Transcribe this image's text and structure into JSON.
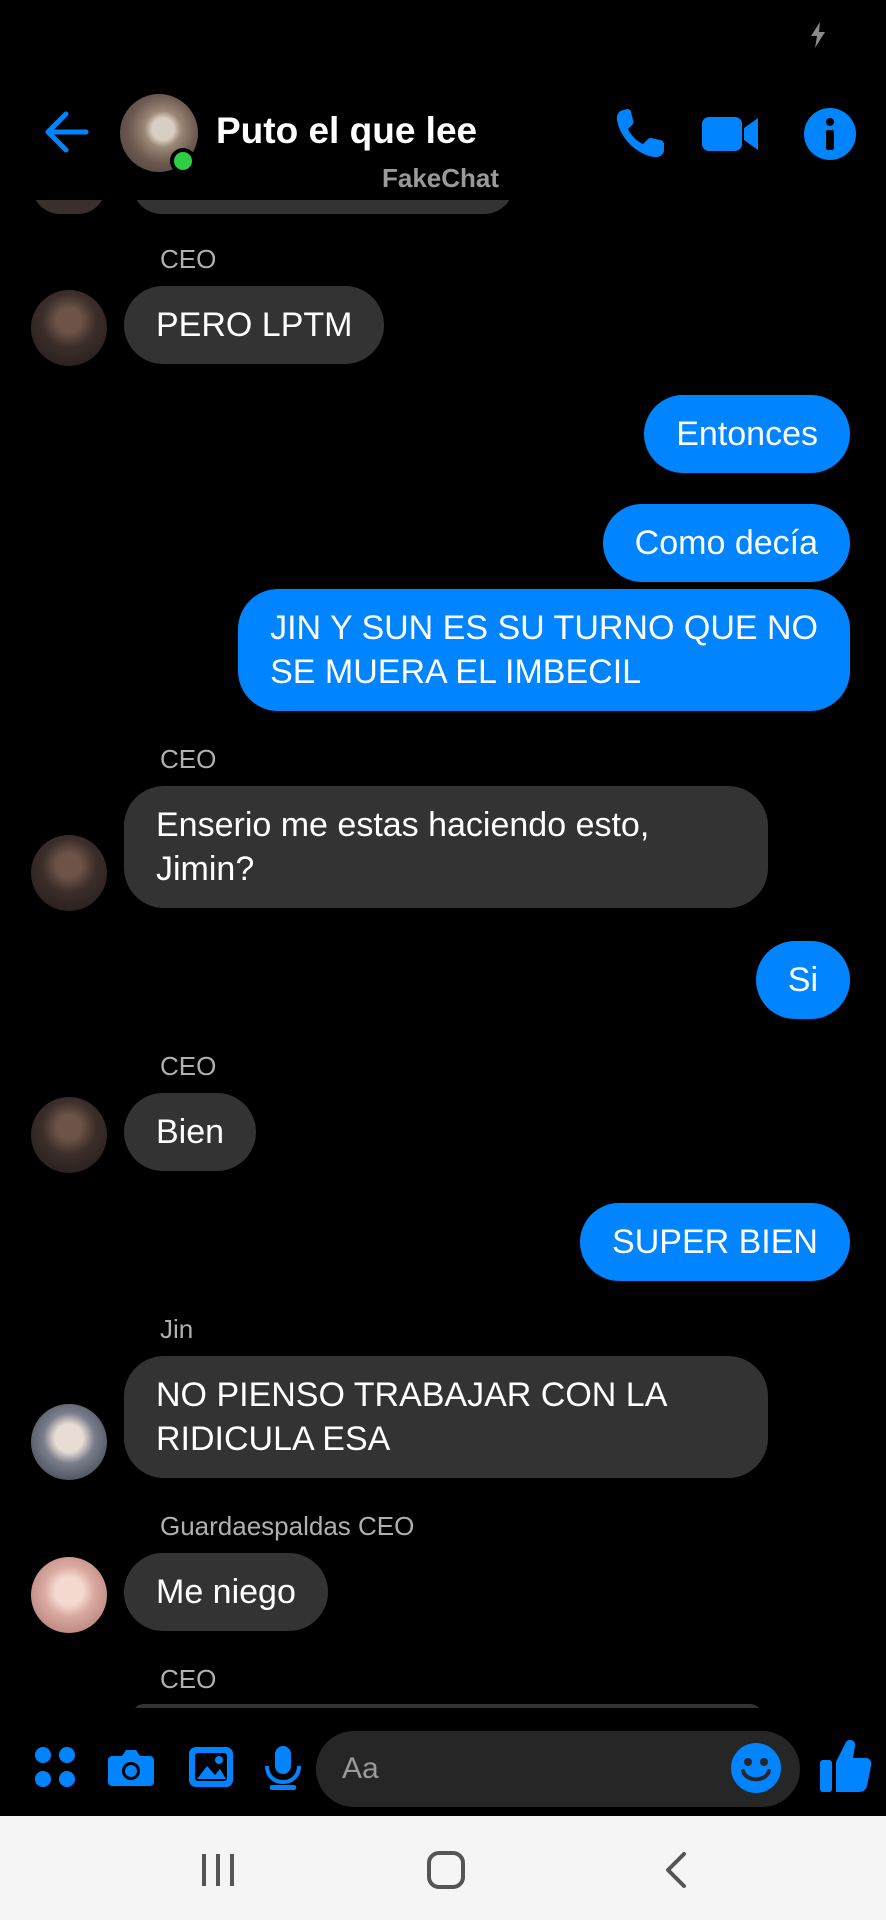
{
  "header": {
    "title": "Puto el que lee",
    "subtitle": "FakeChat",
    "accent": "#0084ff"
  },
  "messages": [
    {
      "sender": "CEO",
      "text": "PERO LPTM"
    },
    {
      "text": "Entonces"
    },
    {
      "text": "Como decía"
    },
    {
      "line1": "JIN Y SUN ES SU TURNO QUE NO",
      "line2": "SE MUERA EL IMBECIL"
    },
    {
      "sender": "CEO",
      "line1": "Enserio me estas haciendo esto,",
      "line2": "Jimin?"
    },
    {
      "text": "Si"
    },
    {
      "sender": "CEO",
      "text": "Bien"
    },
    {
      "text": "SUPER BIEN"
    },
    {
      "sender": "Jin",
      "line1": "NO PIENSO TRABAJAR CON LA",
      "line2": "RIDICULA ESA"
    },
    {
      "sender": "Guardaespaldas CEO",
      "text": "Me niego"
    },
    {
      "sender": "CEO"
    }
  ],
  "composer": {
    "placeholder": "Aa",
    "icons": [
      "apps-icon",
      "camera-icon",
      "gallery-icon",
      "microphone-icon",
      "emoji-icon",
      "thumbs-up-icon"
    ]
  },
  "colors": {
    "incoming_bubble": "#333333",
    "outgoing_bubble": "#0084ff",
    "online": "#31cc46"
  }
}
